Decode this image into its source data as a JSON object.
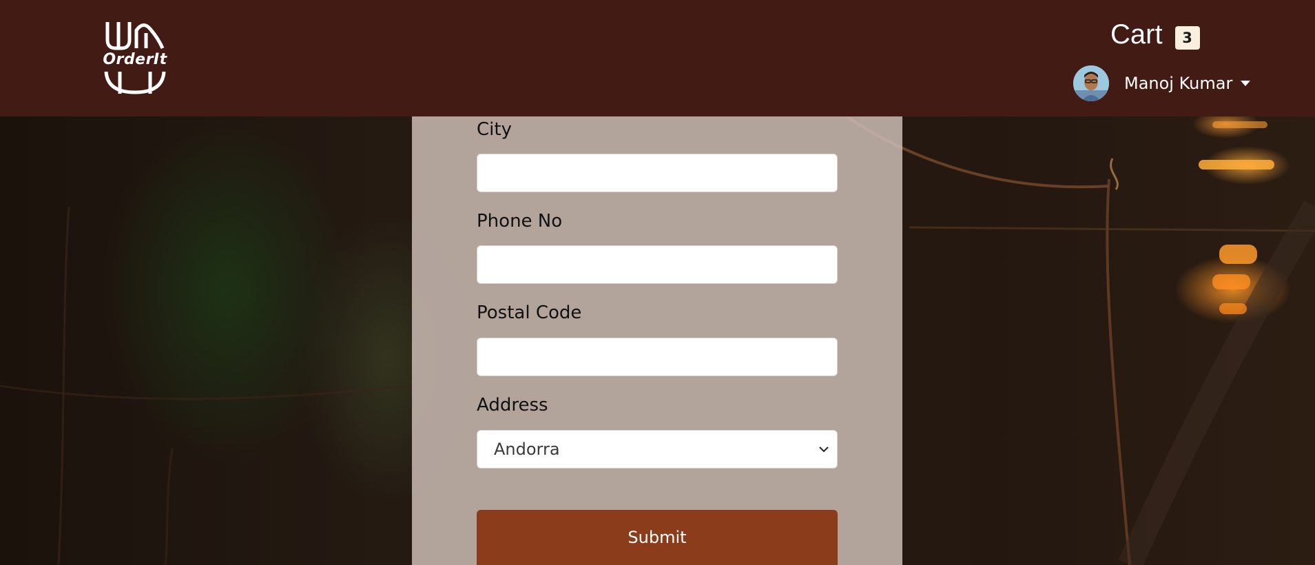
{
  "brand": {
    "logo_text": "OrderIt"
  },
  "nav": {
    "cart_label": "Cart",
    "cart_count": "3",
    "user_name": "Manoj Kumar"
  },
  "form": {
    "city_label": "City",
    "city_value": "",
    "phone_label": "Phone No",
    "phone_value": "",
    "postal_label": "Postal Code",
    "postal_value": "",
    "address_label": "Address",
    "address_selected": "Andorra",
    "submit_label": "Submit"
  },
  "colors": {
    "navbar": "#431b15",
    "submit": "#8b3d1b",
    "badge": "#fbf0e0"
  },
  "icons": {
    "logo": "fork-plate-logo-icon",
    "caret": "caret-down-icon",
    "select_chevron": "chevron-down-icon"
  }
}
